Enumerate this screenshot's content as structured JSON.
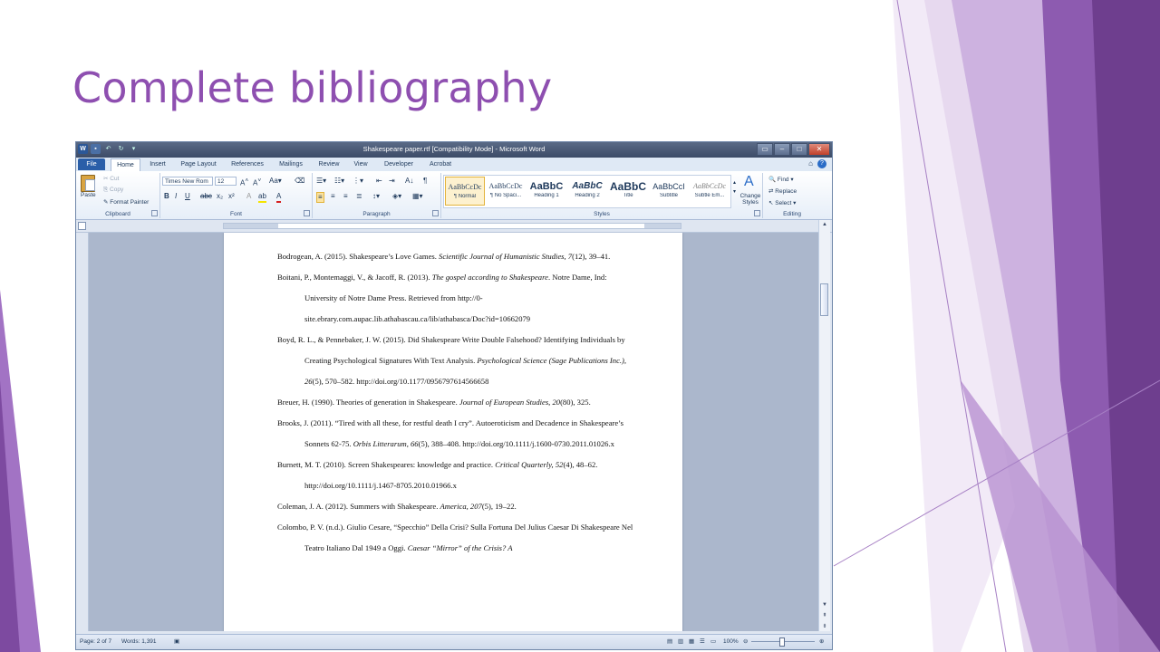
{
  "slide": {
    "title": "Complete bibliography",
    "accent": "#8e4fb0"
  },
  "window": {
    "title": "Shakespeare paper.rtf [Compatibility Mode] - Microsoft Word",
    "qat_icons": [
      "word-logo-icon",
      "save-icon",
      "undo-icon",
      "redo-icon",
      "customize-icon"
    ]
  },
  "tabs": [
    "File",
    "Home",
    "Insert",
    "Page Layout",
    "References",
    "Mailings",
    "Review",
    "View",
    "Developer",
    "Acrobat"
  ],
  "ribbon": {
    "clipboard": {
      "label": "Clipboard",
      "paste": "Paste",
      "cut": "Cut",
      "copy": "Copy",
      "format_painter": "Format Painter"
    },
    "font": {
      "label": "Font",
      "name": "Times New Rom",
      "size": "12"
    },
    "paragraph": {
      "label": "Paragraph"
    },
    "styles": {
      "label": "Styles",
      "items": [
        {
          "sample": "AaBbCcDc",
          "name": "¶ Normal"
        },
        {
          "sample": "AaBbCcDc",
          "name": "¶ No Spaci..."
        },
        {
          "sample": "AaBbC",
          "name": "Heading 1"
        },
        {
          "sample": "AaBbC",
          "name": "Heading 2"
        },
        {
          "sample": "AaBbC",
          "name": "Title"
        },
        {
          "sample": "AaBbCcI",
          "name": "Subtitle"
        },
        {
          "sample": "AaBbCcDc",
          "name": "Subtle Em..."
        }
      ],
      "change_styles": "Change Styles"
    },
    "editing": {
      "label": "Editing",
      "find": "Find",
      "replace": "Replace",
      "select": "Select"
    }
  },
  "document": {
    "entries": [
      {
        "pre": "Bodrogean, A. (2015). Shakespeare’s Love Games. ",
        "it": "Scientific Journal of Humanistic Studies, 7",
        "post": "(12), 39–41."
      },
      {
        "pre": "Boitani, P., Montemaggi, V., & Jacoff, R. (2013). ",
        "it": "The gospel according to Shakespeare",
        "post": ". Notre Dame, Ind: University of Notre Dame Press. Retrieved from http://0-site.ebrary.com.aupac.lib.athabascau.ca/lib/athabasca/Doc?id=10662079"
      },
      {
        "pre": "Boyd, R. L., & Pennebaker, J. W. (2015). Did Shakespeare Write Double Falsehood? Identifying Individuals by Creating Psychological Signatures With Text Analysis. ",
        "it": "Psychological Science (Sage Publications Inc.), 26",
        "post": "(5), 570–582. http://doi.org/10.1177/0956797614566658"
      },
      {
        "pre": "Breuer, H. (1990). Theories of generation in Shakespeare. ",
        "it": "Journal of European Studies, 20",
        "post": "(80), 325."
      },
      {
        "pre": "Brooks, J. (2011). “Tired with all these, for restful death I cry”. Autoeroticism and Decadence in Shakespeare’s Sonnets 62-75. ",
        "it": "Orbis Litterarum, 66",
        "post": "(5), 388–408. http://doi.org/10.1111/j.1600-0730.2011.01026.x"
      },
      {
        "pre": "Burnett, M. T. (2010). Screen Shakespeares: knowledge and practice. ",
        "it": "Critical Quarterly, 52",
        "post": "(4), 48–62. http://doi.org/10.1111/j.1467-8705.2010.01966.x"
      },
      {
        "pre": "Coleman, J. A. (2012). Summers with Shakespeare. ",
        "it": "America, 207",
        "post": "(5), 19–22."
      },
      {
        "pre": "Colombo, P. V. (n.d.). Giulio Cesare, “Specchio” Della Crisi? Sulla Fortuna Del Julius Caesar Di Shakespeare Nel Teatro Italiano Dal 1949 a Oggi. ",
        "it": "Caesar “Mirror” of the Crisis? A",
        "post": ""
      }
    ]
  },
  "status": {
    "page": "Page: 2 of 7",
    "words": "Words: 1,391",
    "zoom": "100%"
  }
}
